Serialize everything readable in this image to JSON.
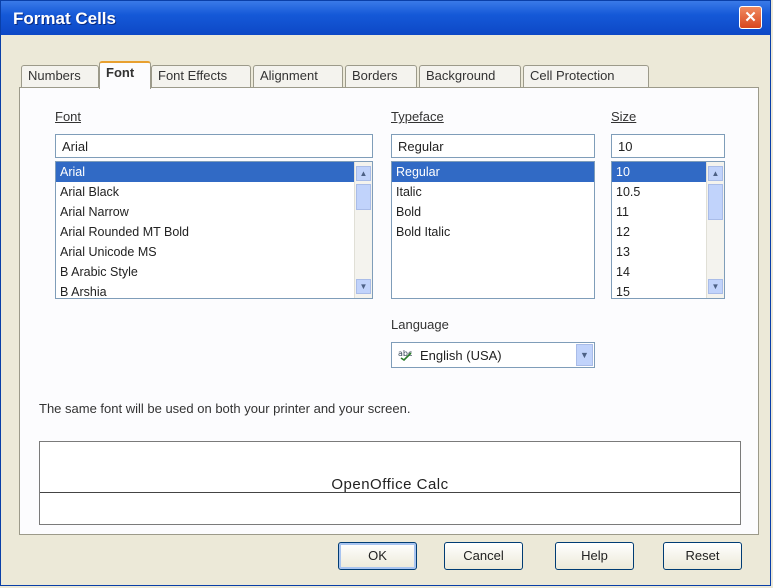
{
  "window": {
    "title": "Format Cells",
    "close_glyph": "✕"
  },
  "tabs": [
    {
      "label": "Numbers",
      "active": false
    },
    {
      "label": "Font",
      "active": true
    },
    {
      "label": "Font Effects",
      "active": false
    },
    {
      "label": "Alignment",
      "active": false
    },
    {
      "label": "Borders",
      "active": false
    },
    {
      "label": "Background",
      "active": false
    },
    {
      "label": "Cell Protection",
      "active": false
    }
  ],
  "font": {
    "label": "Font",
    "value": "Arial",
    "items": [
      "Arial",
      "Arial Black",
      "Arial Narrow",
      "Arial Rounded MT Bold",
      "Arial Unicode MS",
      "B Arabic Style",
      "B Arshia"
    ],
    "selected": "Arial"
  },
  "typeface": {
    "label": "Typeface",
    "value": "Regular",
    "items": [
      "Regular",
      "Italic",
      "Bold",
      "Bold Italic"
    ],
    "selected": "Regular"
  },
  "size": {
    "label": "Size",
    "value": "10",
    "items": [
      "10",
      "10.5",
      "11",
      "12",
      "13",
      "14",
      "15"
    ],
    "selected": "10"
  },
  "language": {
    "label": "Language",
    "value": "English (USA)"
  },
  "info_text": "The same font will be used on both your printer and your screen.",
  "preview_text": "OpenOffice Calc",
  "buttons": {
    "ok": "OK",
    "cancel": "Cancel",
    "help": "Help",
    "reset": "Reset"
  },
  "icons": {
    "language": "spellcheck-language-icon",
    "scroll_up": "▲",
    "scroll_down": "▼",
    "dropdown": "▼"
  }
}
